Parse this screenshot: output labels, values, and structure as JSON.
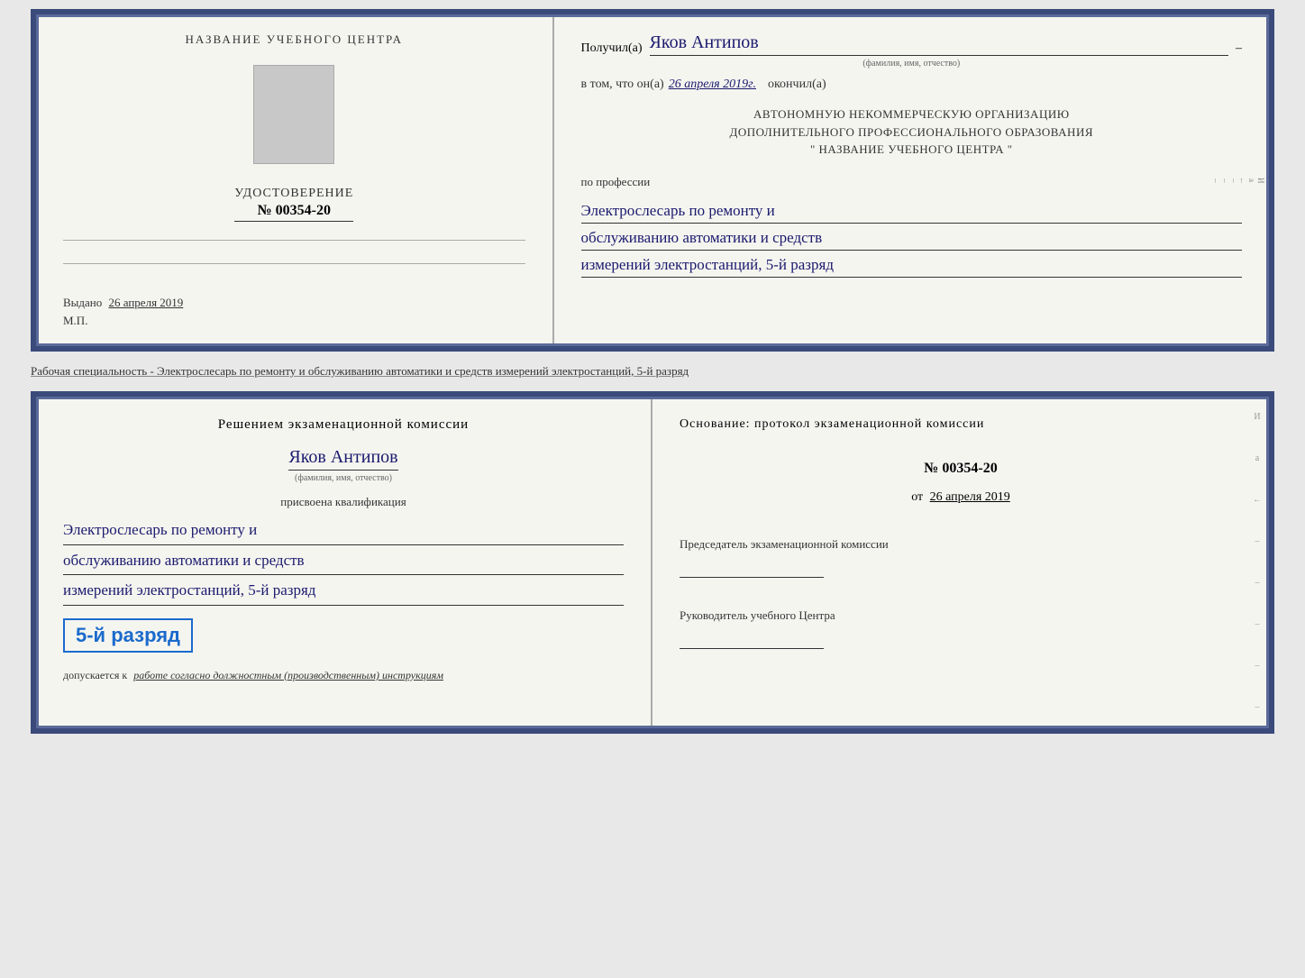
{
  "top_left": {
    "school_name": "НАЗВАНИЕ УЧЕБНОГО ЦЕНТРА",
    "cert_title": "УДОСТОВЕРЕНИЕ",
    "cert_number": "№ 00354-20",
    "issued_label": "Выдано",
    "issued_date": "26 апреля 2019",
    "mp_label": "М.П."
  },
  "top_right": {
    "received_label": "Получил(а)",
    "recipient_name": "Яков Антипов",
    "fio_hint": "(фамилия, имя, отчество)",
    "date_prefix": "в том, что он(а)",
    "date_value": "26 апреля 2019г.",
    "finished_label": "окончил(а)",
    "org_line1": "АВТОНОМНУЮ НЕКОММЕРЧЕСКУЮ ОРГАНИЗАЦИЮ",
    "org_line2": "ДОПОЛНИТЕЛЬНОГО ПРОФЕССИОНАЛЬНОГО ОБРАЗОВАНИЯ",
    "org_name": "\"  НАЗВАНИЕ УЧЕБНОГО ЦЕНТРА  \"",
    "profession_label": "по профессии",
    "profession_line1": "Электрослесарь по ремонту и",
    "profession_line2": "обслуживанию автоматики и средств",
    "profession_line3": "измерений электростанций, 5-й разряд",
    "side_chars": [
      "И",
      "а",
      "←",
      "–",
      "–",
      "–",
      "–"
    ]
  },
  "description_text": "Рабочая специальность - Электрослесарь по ремонту и обслуживанию автоматики и средств измерений электростанций, 5-й разряд",
  "bottom_left": {
    "decision_text": "Решением экзаменационной комиссии",
    "person_name": "Яков Антипов",
    "fio_hint": "(фамилия, имя, отчество)",
    "assigned_label": "присвоена квалификация",
    "qual_line1": "Электрослесарь по ремонту и",
    "qual_line2": "обслуживанию автоматики и средств",
    "qual_line3": "измерений электростанций, 5-й разряд",
    "grade_badge": "5-й разряд",
    "allowed_prefix": "допускается к",
    "allowed_text": "работе согласно должностным (производственным) инструкциям"
  },
  "bottom_right": {
    "basis_label": "Основание: протокол экзаменационной комиссии",
    "protocol_number": "№ 00354-20",
    "date_prefix": "от",
    "date_value": "26 апреля 2019",
    "chairman_role": "Председатель экзаменационной комиссии",
    "director_role": "Руководитель учебного Центра",
    "side_chars": [
      "И",
      "а",
      "←",
      "–",
      "–",
      "–",
      "–",
      "–"
    ]
  }
}
